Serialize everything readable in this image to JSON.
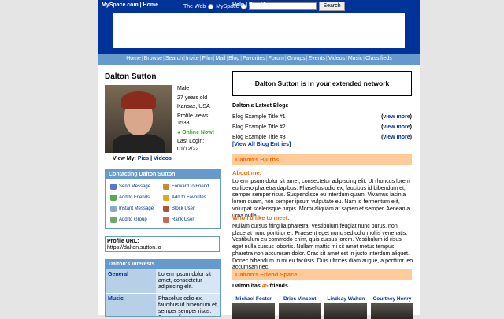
{
  "top_nav": {
    "brand": "MySpace.com",
    "home": "Home",
    "web_label": "The Web",
    "myspace_label": "MySpace",
    "search_button": "Search",
    "help": "Help",
    "signup": "SignUp"
  },
  "menu": [
    "Home",
    "Browse",
    "Search",
    "Invite",
    "Film",
    "Mail",
    "Blog",
    "Favorites",
    "Forum",
    "Groups",
    "Events",
    "Videos",
    "Music",
    "Classifieds"
  ],
  "profile": {
    "name": "Dalton Sutton",
    "gender": "Male",
    "age": "27 years old",
    "location": "Kansas, USA",
    "views_label": "Profile views:",
    "views": "1533",
    "online": "Online Now!",
    "last_login_label": "Last Login:",
    "last_login": "01/12/22",
    "view_my_label": "View My:",
    "pics": "Pics",
    "videos": "Videos"
  },
  "contact": {
    "title": "Contacting Dalton Sutton",
    "items": [
      {
        "label": "Send Message",
        "icon": "envelope-icon",
        "color": "#5577cc"
      },
      {
        "label": "Forward to Friend",
        "icon": "forward-icon",
        "color": "#cc8833"
      },
      {
        "label": "Add to Friends",
        "icon": "add-friend-icon",
        "color": "#55aa55"
      },
      {
        "label": "Add to Favorites",
        "icon": "star-icon",
        "color": "#ddaa22"
      },
      {
        "label": "Instant Message",
        "icon": "chat-icon",
        "color": "#88aacc"
      },
      {
        "label": "Block User",
        "icon": "block-icon",
        "color": "#aa5533"
      },
      {
        "label": "Add to Group",
        "icon": "group-icon",
        "color": "#66aa66"
      },
      {
        "label": "Rank User",
        "icon": "rank-icon",
        "color": "#cc6655"
      }
    ]
  },
  "profile_url": {
    "label": "Profile URL:",
    "value": "https://dalton.sutton.io"
  },
  "interests": {
    "title": "Dalton's Interests",
    "rows": [
      {
        "key": "General",
        "value": "Lorem ipsum dolor sit amet, consectetur adipiscing elit."
      },
      {
        "key": "Music",
        "value": "Phasellus odio ex, faucibus id bibendum et, semper semper risus. Suspendisse"
      }
    ]
  },
  "network_text": "Dalton Sutton is in your extended network",
  "blogs": {
    "title": "Dalton's Latest Blogs",
    "entries": [
      "Blog Example Title #1",
      "Blog Example Title #2",
      "Blog Example Title #3"
    ],
    "view_more": "view more",
    "view_all": "[View All Blog Entries]"
  },
  "blurbs": {
    "title": "Dalton's Blurbs",
    "about_label": "About me:",
    "about_text": "Lorem ipsum dolor sit amet, consectetur adipiscing elit. Ut rhoncus lorem eu libero pharetra dapibus. Phasellus odio ex, faucibus id bibendum et, semper semper risus. Suspendisse eu interdum quam. Vivamus lacinia lorem quam, non semper ipsum vulputate eu. Nam id fermentum elit, volutpat scelerisque turpis. Morbi aliquam at sapien et semper. Aenean a urna nulla.",
    "meet_label": "Who I'd like to meet:",
    "meet_text": "Nullam cursus fringilla pharetra. Vestibulum feugiat nunc purus, non placerat nunc porttitor et. Praesent eget nunc sed odio mollis venenatis. Vestibulum eu commodo enim, quis cursus lorem. Vestibulum id risus eget nulla cursus lobortis. Nullam mattis mi sit amet metus tempus pharetra non accumsan dolor. Cras sit amet est in justo interdum aliquet. Donec bibendum in mi eu facilisis. Duis ultrices diam augue, a porttitor leo accumsan nec."
  },
  "friends": {
    "title": "Dalton's Friend Space",
    "prefix": "Dalton has",
    "count": "45",
    "suffix": "friends.",
    "list": [
      "Michael Foster",
      "Dries Vincent",
      "Lindsay Walton",
      "Courtney Henry"
    ]
  }
}
